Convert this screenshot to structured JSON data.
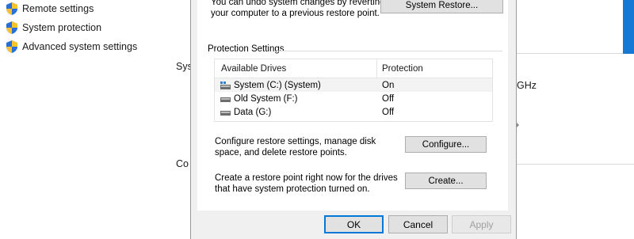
{
  "control_panel": {
    "links": [
      {
        "label": "Remote settings",
        "icon": "uac-shield-icon"
      },
      {
        "label": "System protection",
        "icon": "uac-shield-icon"
      },
      {
        "label": "Advanced system settings",
        "icon": "uac-shield-icon"
      }
    ],
    "fragments": {
      "sys": "Sys",
      "cor": "Co",
      "ghz": "GHz"
    }
  },
  "dialog": {
    "intro_text": "You can undo system changes by reverting your computer to a previous restore point.",
    "system_restore_button": "System Restore...",
    "protection_group_label": "Protection Settings",
    "drives_table": {
      "headers": [
        "Available Drives",
        "Protection"
      ],
      "rows": [
        {
          "drive": "System (C:) (System)",
          "protection": "On",
          "icon": "system-drive-icon"
        },
        {
          "drive": "Old System (F:)",
          "protection": "Off",
          "icon": "drive-icon"
        },
        {
          "drive": "Data (G:)",
          "protection": "Off",
          "icon": "drive-icon"
        }
      ]
    },
    "configure_text": "Configure restore settings, manage disk space, and delete restore points.",
    "configure_button": "Configure...",
    "create_text": "Create a restore point right now for the drives that have system protection turned on.",
    "create_button": "Create...",
    "ok_button": "OK",
    "cancel_button": "Cancel",
    "apply_button": "Apply"
  },
  "colors": {
    "accent": "#0078d7",
    "title_strip": "#1479d4"
  }
}
